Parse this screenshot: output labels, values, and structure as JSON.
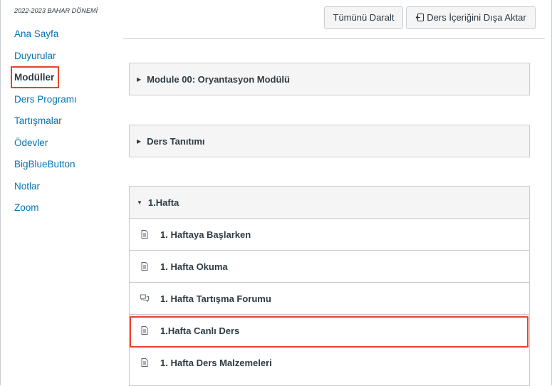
{
  "sidebar": {
    "term": "2022-2023 BAHAR DÖNEMİ",
    "items": [
      {
        "label": "Ana Sayfa"
      },
      {
        "label": "Duyurular"
      },
      {
        "label": "Modüller"
      },
      {
        "label": "Ders Programı"
      },
      {
        "label": "Tartışmalar"
      },
      {
        "label": "Ödevler"
      },
      {
        "label": "BigBlueButton"
      },
      {
        "label": "Notlar"
      },
      {
        "label": "Zoom"
      }
    ]
  },
  "toolbar": {
    "collapse_all_label": "Tümünü Daralt",
    "export_label": "Ders İçeriğini Dışa Aktar"
  },
  "modules": [
    {
      "title": "Module 00: Oryantasyon Modülü",
      "expanded": false
    },
    {
      "title": "Ders Tanıtımı",
      "expanded": false
    },
    {
      "title": "1.Hafta",
      "expanded": true,
      "items": [
        {
          "title": "1. Haftaya Başlarken",
          "icon": "page-icon"
        },
        {
          "title": "1. Hafta Okuma",
          "icon": "page-icon"
        },
        {
          "title": "1. Hafta Tartışma Forumu",
          "icon": "discussion-icon"
        },
        {
          "title": "1.Hafta Canlı Ders",
          "icon": "page-icon"
        },
        {
          "title": "1. Hafta Ders Malzemeleri",
          "icon": "page-icon"
        }
      ]
    }
  ],
  "colors": {
    "link": "#0374b5",
    "text": "#2d3b45",
    "highlight": "#e8432e",
    "header_bg": "#f5f5f5",
    "border": "#c7cdd1"
  }
}
